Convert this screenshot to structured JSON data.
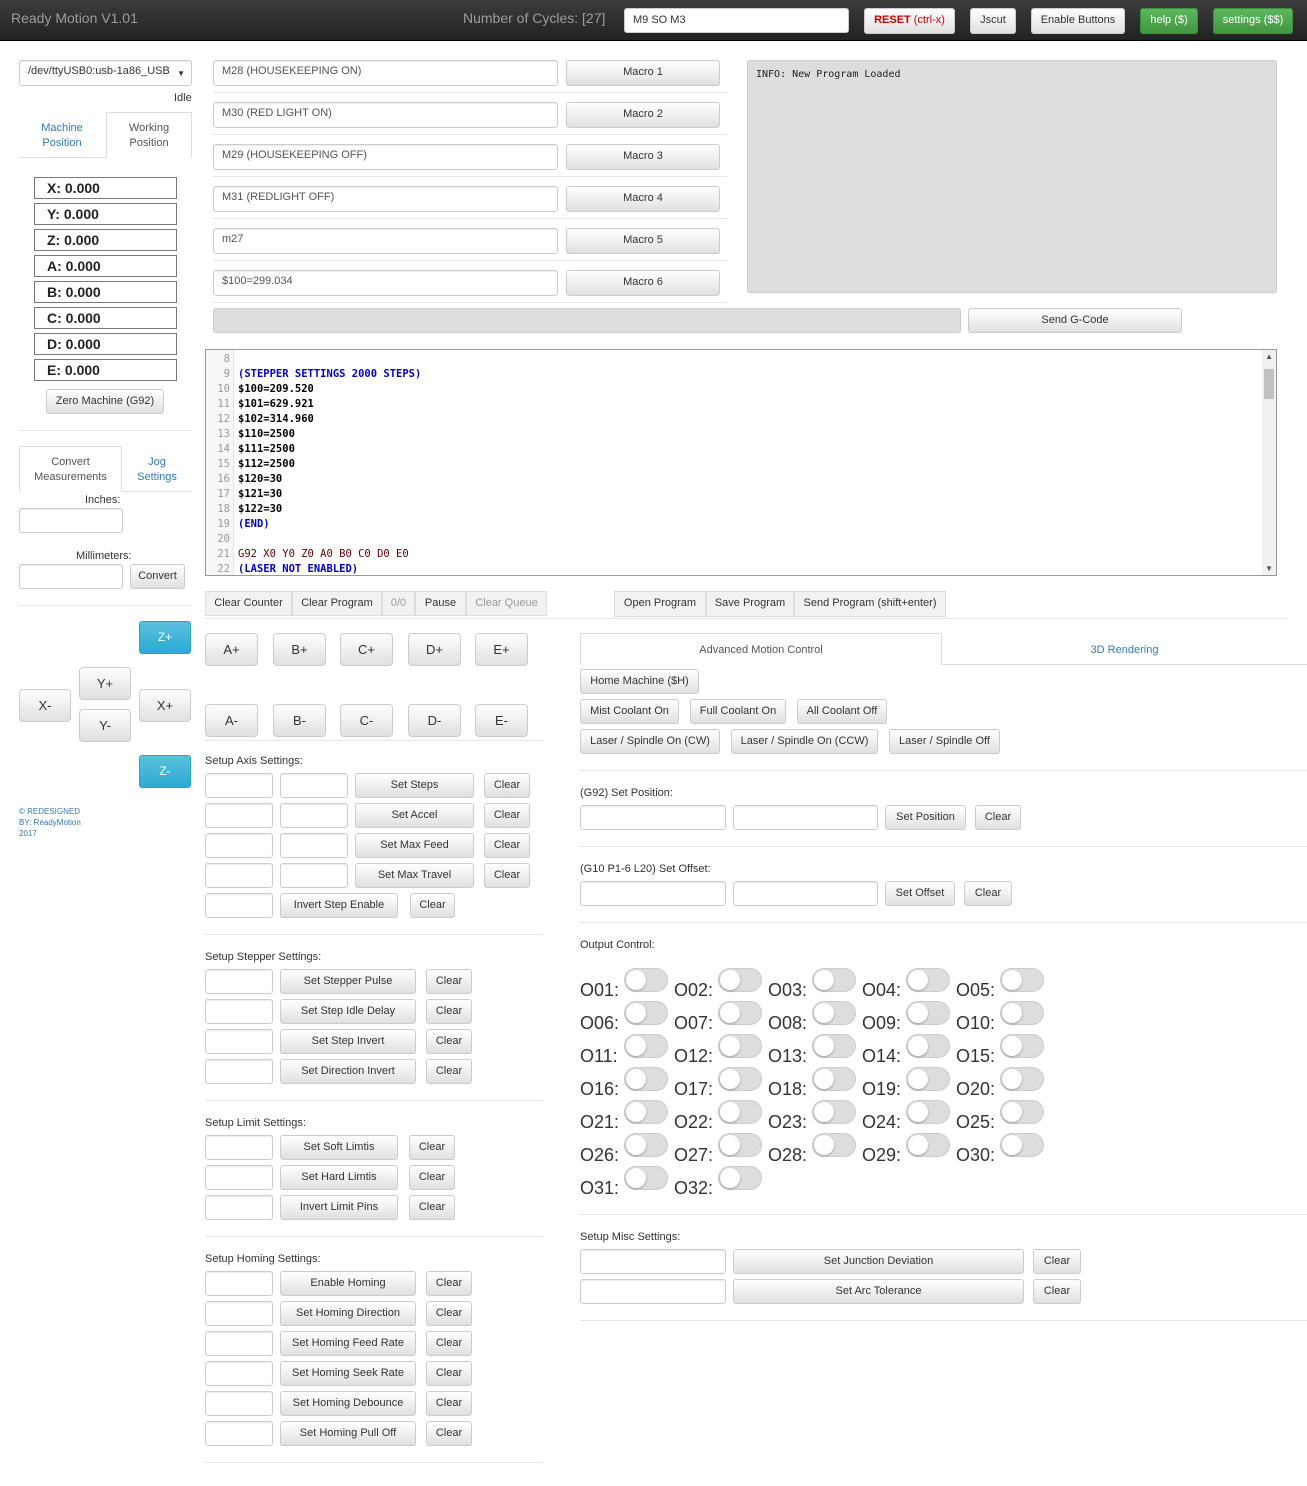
{
  "navbar": {
    "brand": "Ready Motion V1.01",
    "cycles": "Number of Cycles: [27]",
    "command_value": "M9 SO M3",
    "reset_label": "RESET",
    "reset_key": "(ctrl-x)",
    "jscut": "Jscut",
    "enable_buttons": "Enable Buttons",
    "help": "help ($)",
    "settings": "settings ($$)"
  },
  "connection": {
    "port": "/dev/ttyUSB0:usb-1a86_USB",
    "status": "Idle"
  },
  "position_tabs": {
    "machine": "Machine\nPosition",
    "working": "Working\nPosition"
  },
  "coords": [
    {
      "label": "X:",
      "value": "0.000"
    },
    {
      "label": "Y:",
      "value": "0.000"
    },
    {
      "label": "Z:",
      "value": "0.000"
    },
    {
      "label": "A:",
      "value": "0.000"
    },
    {
      "label": "B:",
      "value": "0.000"
    },
    {
      "label": "C:",
      "value": "0.000"
    },
    {
      "label": "D:",
      "value": "0.000"
    },
    {
      "label": "E:",
      "value": "0.000"
    }
  ],
  "zero_machine": "Zero Machine (G92)",
  "convert": {
    "tab_convert": "Convert\nMeasurements",
    "tab_jog": "Jog\nSettings",
    "inches_label": "Inches:",
    "mm_label": "Millimeters:",
    "convert_button": "Convert"
  },
  "jog": {
    "zplus": "Z+",
    "zminus": "Z-",
    "xplus": "X+",
    "xminus": "X-",
    "yplus": "Y+",
    "yminus": "Y-"
  },
  "footer": {
    "line1": "© REDESIGNED",
    "line2": "BY: ReadyMotion",
    "line3": "2017"
  },
  "macros": [
    {
      "value": "M28 (HOUSEKEEPING ON)",
      "label": "Macro 1"
    },
    {
      "value": "M30 (RED LIGHT ON)",
      "label": "Macro 2"
    },
    {
      "value": "M29 (HOUSEKEEPING OFF)",
      "label": "Macro 3"
    },
    {
      "value": "M31 (REDLIGHT OFF)",
      "label": "Macro 4"
    },
    {
      "value": "m27",
      "label": "Macro 5"
    },
    {
      "value": "$100=299.034",
      "label": "Macro 6"
    }
  ],
  "console_text": "INFO: New Program Loaded",
  "send_gcode": "Send G-Code",
  "editor": {
    "lines": [
      {
        "n": "8",
        "text": "",
        "kind": "gcode"
      },
      {
        "n": "9",
        "text": "(STEPPER SETTINGS 2000 STEPS)",
        "kind": "comment"
      },
      {
        "n": "10",
        "text": "$100=209.520",
        "kind": "gcode"
      },
      {
        "n": "11",
        "text": "$101=629.921",
        "kind": "gcode"
      },
      {
        "n": "12",
        "text": "$102=314.960",
        "kind": "gcode"
      },
      {
        "n": "13",
        "text": "$110=2500",
        "kind": "gcode"
      },
      {
        "n": "14",
        "text": "$111=2500",
        "kind": "gcode"
      },
      {
        "n": "15",
        "text": "$112=2500",
        "kind": "gcode"
      },
      {
        "n": "16",
        "text": "$120=30",
        "kind": "gcode"
      },
      {
        "n": "17",
        "text": "$121=30",
        "kind": "gcode"
      },
      {
        "n": "18",
        "text": "$122=30",
        "kind": "gcode"
      },
      {
        "n": "19",
        "text": "(END)",
        "kind": "comment"
      },
      {
        "n": "20",
        "text": "",
        "kind": "gcode"
      },
      {
        "n": "21",
        "text": "G92 X0 Y0 Z0 A0 B0 C0 D0 E0",
        "kind": "g92"
      },
      {
        "n": "22",
        "text": "(LASER NOT ENABLED)",
        "kind": "comment"
      }
    ]
  },
  "queue": {
    "clear_counter": "Clear Counter",
    "clear_program": "Clear Program",
    "count": "0/0",
    "pause": "Pause",
    "clear_queue": "Clear Queue",
    "open_program": "Open Program",
    "save_program": "Save Program",
    "send_program": "Send Program (shift+enter)"
  },
  "axis_buttons": {
    "plus": [
      "A+",
      "B+",
      "C+",
      "D+",
      "E+"
    ],
    "minus": [
      "A-",
      "B-",
      "C-",
      "D-",
      "E-"
    ]
  },
  "setup_axis": {
    "title": "Setup Axis Settings:",
    "rows": [
      "Set Steps",
      "Set Accel",
      "Set Max Feed",
      "Set Max Travel"
    ],
    "invert": "Invert Step Enable",
    "clear": "Clear"
  },
  "setup_stepper": {
    "title": "Setup Stepper Settings:",
    "rows": [
      "Set Stepper Pulse",
      "Set Step Idle Delay",
      "Set Step Invert",
      "Set Direction Invert"
    ],
    "clear": "Clear"
  },
  "setup_limit": {
    "title": "Setup Limit Settings:",
    "rows": [
      "Set Soft Limtis",
      "Set Hard Limtis",
      "Invert Limit Pins"
    ],
    "clear": "Clear"
  },
  "setup_homing": {
    "title": "Setup Homing Settings:",
    "rows": [
      "Enable Homing",
      "Set Homing Direction",
      "Set Homing Feed Rate",
      "Set Homing Seek Rate",
      "Set Homing Debounce",
      "Set Homing Pull Off"
    ],
    "clear": "Clear"
  },
  "right_tabs": {
    "advanced": "Advanced Motion Control",
    "rendering": "3D Rendering"
  },
  "motion": {
    "home": "Home Machine ($H)",
    "mist": "Mist Coolant On",
    "full": "Full Coolant On",
    "all_off": "All Coolant Off",
    "cw": "Laser / Spindle On (CW)",
    "ccw": "Laser / Spindle On (CCW)",
    "off": "Laser / Spindle Off"
  },
  "g92": {
    "title": "(G92) Set Position:",
    "button": "Set Position",
    "clear": "Clear"
  },
  "g10": {
    "title": "(G10 P1-6 L20) Set Offset:",
    "button": "Set Offset",
    "clear": "Clear"
  },
  "output": {
    "title": "Output Control:",
    "labels": [
      "O01:",
      "O02:",
      "O03:",
      "O04:",
      "O05:",
      "O06:",
      "O07:",
      "O08:",
      "O09:",
      "O10:",
      "O11:",
      "O12:",
      "O13:",
      "O14:",
      "O15:",
      "O16:",
      "O17:",
      "O18:",
      "O19:",
      "O20:",
      "O21:",
      "O22:",
      "O23:",
      "O24:",
      "O25:",
      "O26:",
      "O27:",
      "O28:",
      "O29:",
      "O30:",
      "O31:",
      "O32:"
    ]
  },
  "misc": {
    "title": "Setup Misc Settings:",
    "junction": "Set Junction Deviation",
    "arc": "Set Arc Tolerance",
    "clear": "Clear"
  },
  "colors": {
    "navbar": "#222222",
    "green": "#5cb85c",
    "blue": "#5bc0de",
    "reset_red": "#cc0000",
    "comment_blue": "#0000cc"
  }
}
